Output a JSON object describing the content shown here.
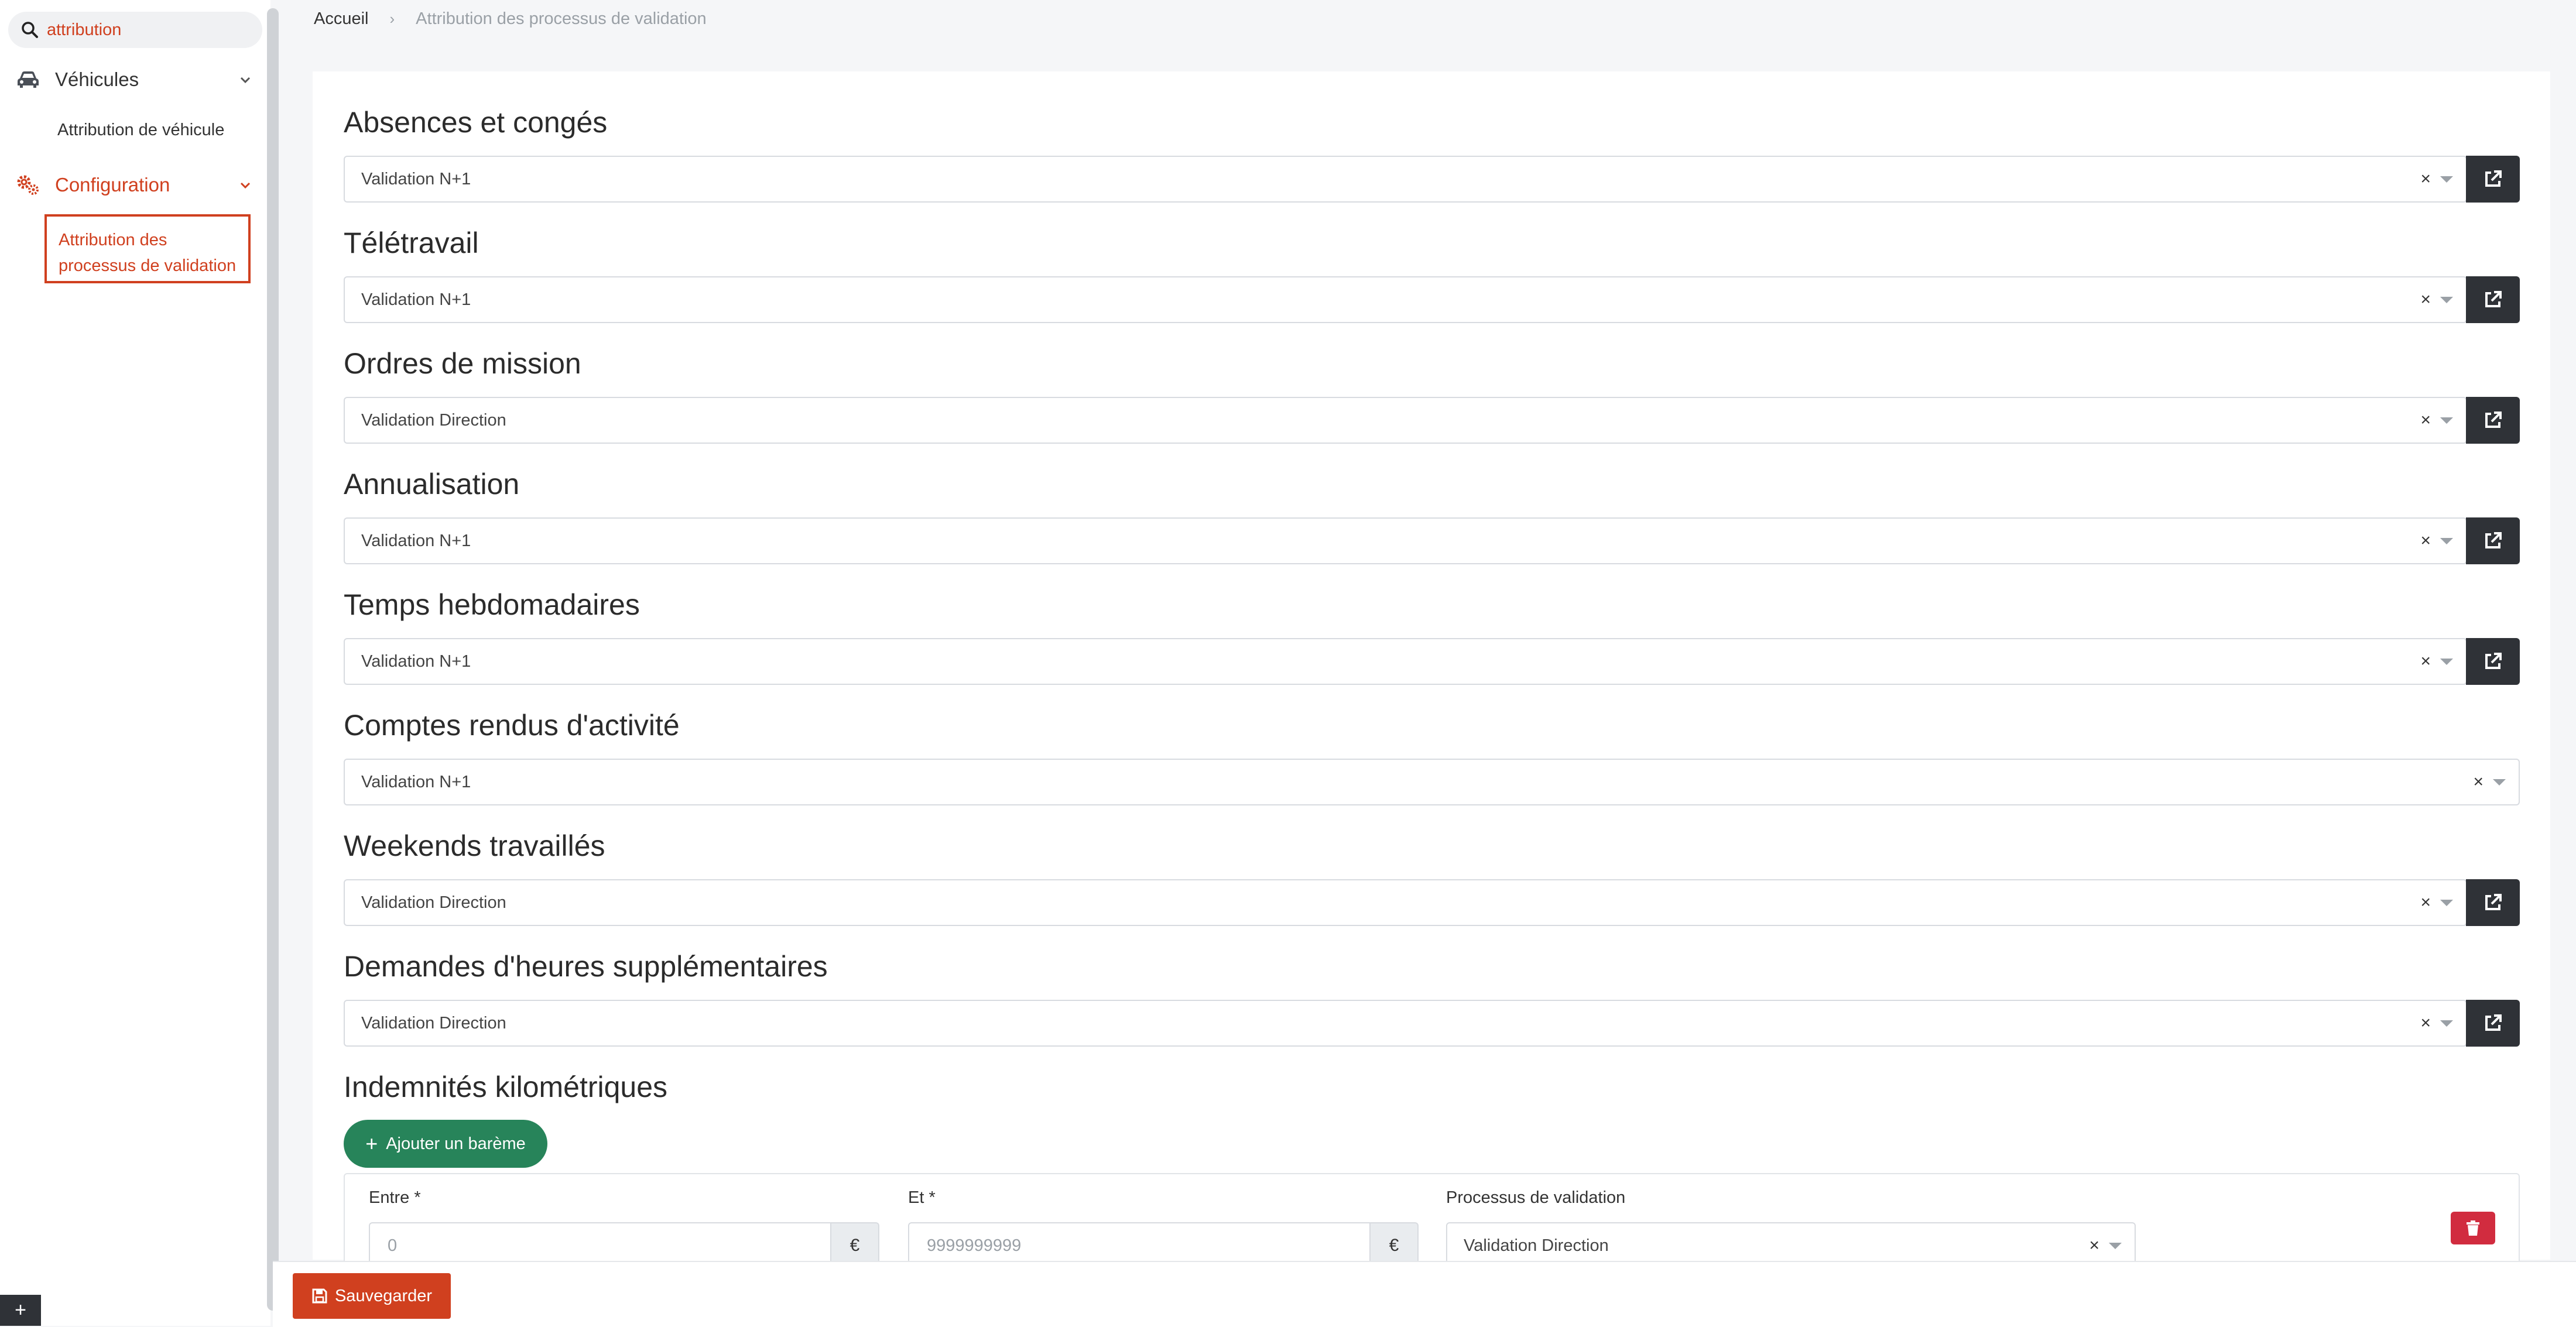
{
  "sidebar": {
    "search_value": "attribution",
    "vehicules_label": "Véhicules",
    "vehicules_sub": "Attribution de véhicule",
    "configuration_label": "Configuration",
    "configuration_sub_line1": "Attribution des",
    "configuration_sub_line2": "processus de validation"
  },
  "breadcrumb": {
    "home": "Accueil",
    "separator": "›",
    "current": "Attribution des processus de validation"
  },
  "sections": [
    {
      "title": "Absences et congés",
      "value": "Validation N+1",
      "has_link": true
    },
    {
      "title": "Télétravail",
      "value": "Validation N+1",
      "has_link": true
    },
    {
      "title": "Ordres de mission",
      "value": "Validation Direction",
      "has_link": true
    },
    {
      "title": "Annualisation",
      "value": "Validation N+1",
      "has_link": true
    },
    {
      "title": "Temps hebdomadaires",
      "value": "Validation N+1",
      "has_link": true
    },
    {
      "title": "Comptes rendus d'activité",
      "value": "Validation N+1",
      "has_link": false
    },
    {
      "title": "Weekends travaillés",
      "value": "Validation Direction",
      "has_link": true
    },
    {
      "title": "Demandes d'heures supplémentaires",
      "value": "Validation Direction",
      "has_link": true
    }
  ],
  "clear_glyph": "×",
  "indemnites": {
    "title": "Indemnités kilométriques",
    "add_label": "Ajouter un barème",
    "add_plus": "+",
    "entre_label": "Entre *",
    "entre_placeholder": "0",
    "et_label": "Et *",
    "et_placeholder": "9999999999",
    "currency": "€",
    "processus_label": "Processus de validation",
    "processus_value": "Validation Direction"
  },
  "footer": {
    "save_label": "Sauvegarder",
    "corner_label": "+"
  },
  "colors": {
    "accent": "#d0401f",
    "success": "#27845a",
    "danger": "#d12c3f",
    "dark_button": "#2f3237"
  },
  "icons": {
    "search": "search-icon",
    "car": "car-icon",
    "cogs": "cogs-icon",
    "chevron": "chevron-down-icon",
    "external": "external-link-icon",
    "trash": "trash-icon",
    "save": "floppy-disk-icon"
  }
}
